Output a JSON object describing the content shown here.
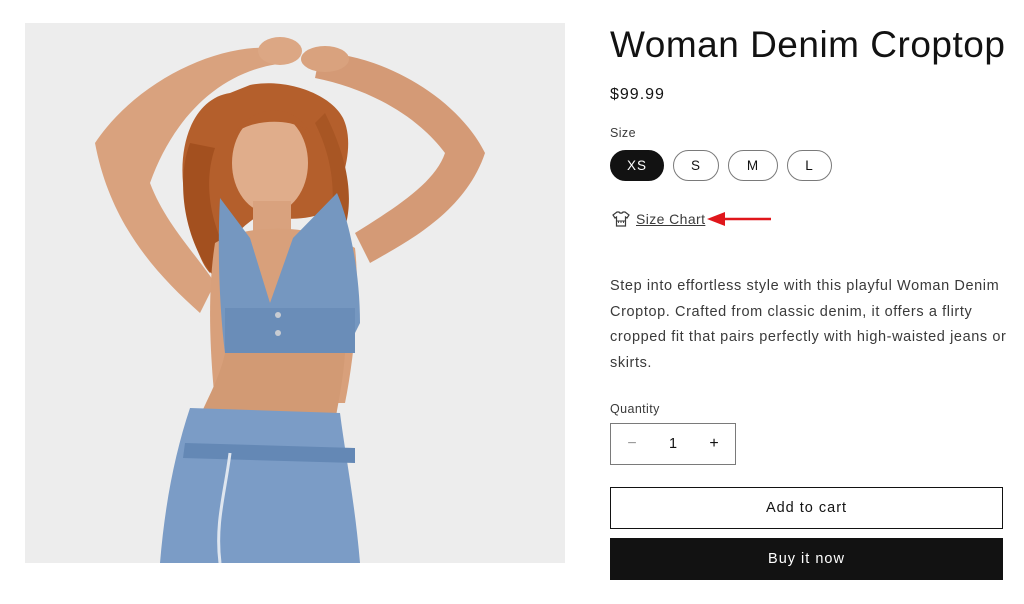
{
  "product": {
    "title": "Woman Denim Croptop",
    "price": "$99.99",
    "size_label": "Size",
    "sizes": [
      "XS",
      "S",
      "M",
      "L"
    ],
    "selected_size": "XS",
    "size_chart_label": "Size Chart",
    "description": "Step into effortless style with this playful Woman Denim Croptop. Crafted from classic denim, it offers a flirty cropped fit that pairs perfectly with high-waisted jeans or skirts.",
    "quantity_label": "Quantity",
    "quantity_value": "1",
    "add_to_cart_label": "Add to cart",
    "buy_now_label": "Buy it now"
  },
  "icons": {
    "minus": "−",
    "plus": "+",
    "size_chart": "shirt-icon",
    "arrow": "red-arrow-left"
  },
  "colors": {
    "text": "#121212",
    "selected_pill_bg": "#121212",
    "buy_now_bg": "#121212",
    "annotation_arrow": "#e0161b"
  }
}
